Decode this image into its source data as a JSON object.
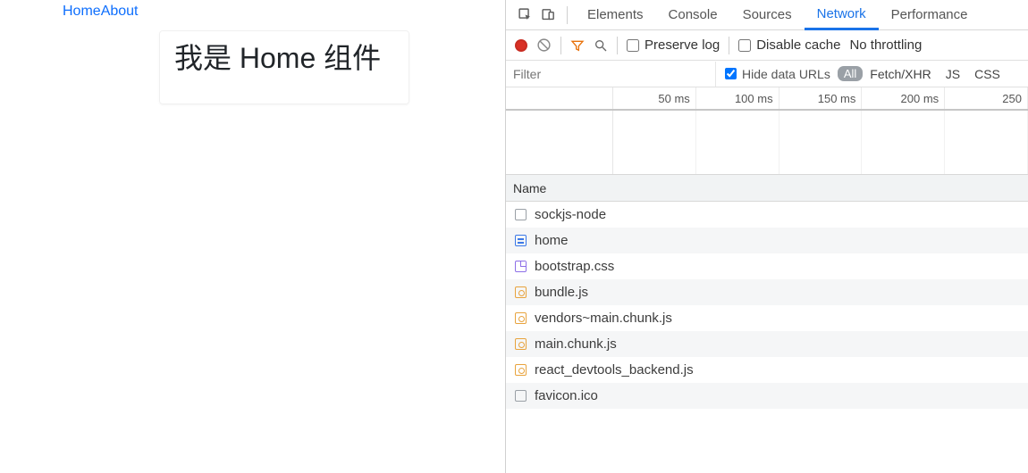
{
  "page": {
    "nav": {
      "home": "Home",
      "about": "About"
    },
    "heading": "我是 Home 组件"
  },
  "devtools": {
    "tabs": {
      "elements": "Elements",
      "console": "Console",
      "sources": "Sources",
      "network": "Network",
      "performance": "Performance",
      "active": "Network"
    },
    "toolbar": {
      "preserve_log": "Preserve log",
      "disable_cache": "Disable cache",
      "throttling": "No throttling"
    },
    "filter": {
      "placeholder": "Filter",
      "hide_data_urls": "Hide data URLs",
      "hide_data_urls_checked": true,
      "type_all": "All",
      "type_fetch": "Fetch/XHR",
      "type_js": "JS",
      "type_css": "CSS"
    },
    "timeline": {
      "ticks": [
        "50 ms",
        "100 ms",
        "150 ms",
        "200 ms",
        "250 "
      ]
    },
    "requests": {
      "header_name": "Name",
      "rows": [
        {
          "icon": "box",
          "name": "sockjs-node"
        },
        {
          "icon": "doc",
          "name": "home"
        },
        {
          "icon": "css",
          "name": "bootstrap.css"
        },
        {
          "icon": "js",
          "name": "bundle.js"
        },
        {
          "icon": "js",
          "name": "vendors~main.chunk.js"
        },
        {
          "icon": "js",
          "name": "main.chunk.js"
        },
        {
          "icon": "js",
          "name": "react_devtools_backend.js"
        },
        {
          "icon": "box",
          "name": "favicon.ico"
        }
      ]
    }
  }
}
